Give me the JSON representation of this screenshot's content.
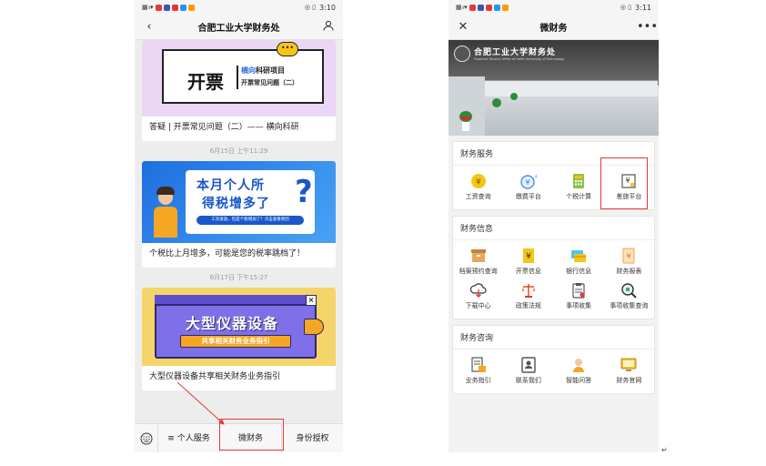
{
  "left_phone": {
    "status": {
      "time": "3:10"
    },
    "nav": {
      "title": "合肥工业大学财务处",
      "back_icon": "chevron-left-icon",
      "profile_icon": "person-icon"
    },
    "feed": [
      {
        "banner": {
          "big": "开票",
          "line1a": "横向",
          "line1b": "科研项目",
          "line2": "开票常见问题（二）"
        },
        "title": "答疑 | 开票常见问题（二）—— 横向科研"
      },
      {
        "timestamp": "6月15日 上午11:29",
        "banner": {
          "line1": "本月个人所",
          "line2": "得税增多了",
          "qmark": "?",
          "caption": "工资发放，但是个税增加了？点击查看原因"
        },
        "title": "个税比上月增多，可能是您的税率跳档了！"
      },
      {
        "timestamp": "6月17日 下午15:27",
        "banner": {
          "line1": "大型仪器设备",
          "line2": "共享相关财务业务指引"
        },
        "title": "大型仪器设备共享相关财务业务指引"
      }
    ],
    "menu": {
      "item1": "≡ 个人服务",
      "item2": "微财务",
      "item3": "身份授权"
    }
  },
  "right_phone": {
    "status": {
      "time": "3:11"
    },
    "nav": {
      "title": "微财务",
      "close_icon": "close-icon",
      "more_icon": "more-icon"
    },
    "hero": {
      "logo_text": "合肥工业大学财务处",
      "subtitle": "Financial Service Office of Hefei University of Technology"
    },
    "sections": [
      {
        "title": "财务服务",
        "items": [
          "工资查询",
          "缴费平台",
          "个税计算",
          "差旅平台"
        ]
      },
      {
        "title": "财务信息",
        "items": [
          "档案预约查询",
          "开票信息",
          "银行信息",
          "财务报表",
          "下载中心",
          "政策法规",
          "事项收集",
          "事项收集查询"
        ]
      },
      {
        "title": "财务咨询",
        "items": [
          "业务指引",
          "联系我们",
          "智能问答",
          "财务官网"
        ]
      }
    ]
  },
  "colors": {
    "highlight_red": "#e53935",
    "wechat_green": "#07c160"
  }
}
